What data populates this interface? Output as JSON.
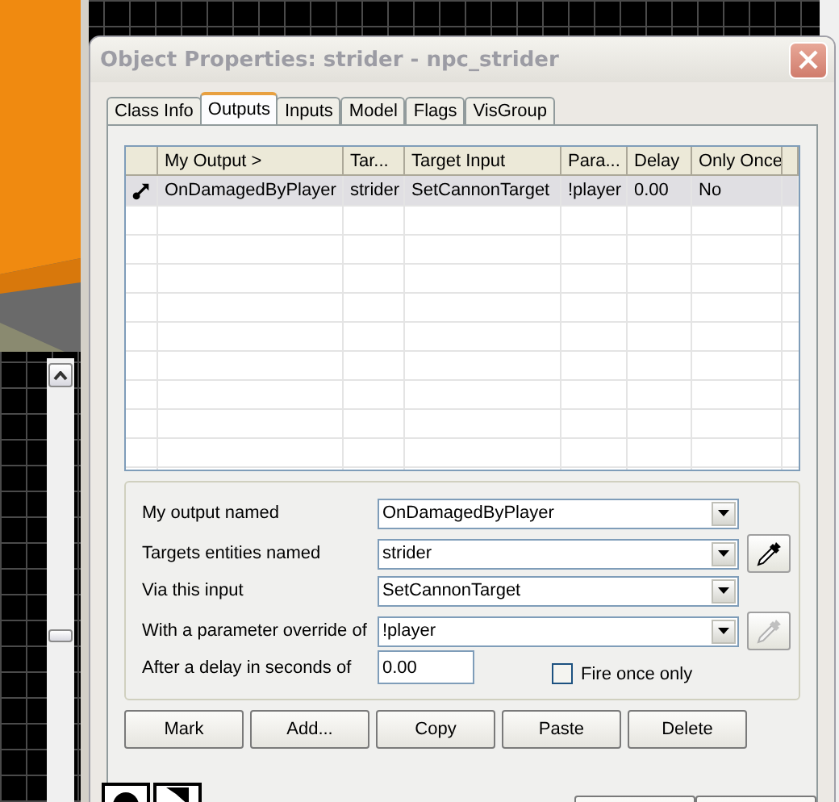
{
  "window": {
    "title": "Object Properties: strider - npc_strider",
    "active": false
  },
  "tabs": [
    {
      "label": "Class Info",
      "selected": false
    },
    {
      "label": "Outputs",
      "selected": true
    },
    {
      "label": "Inputs",
      "selected": false
    },
    {
      "label": "Model",
      "selected": false
    },
    {
      "label": "Flags",
      "selected": false
    },
    {
      "label": "VisGroup",
      "selected": false
    }
  ],
  "table": {
    "columns": [
      "My Output >",
      "Tar...",
      "Target Input",
      "Para...",
      "Delay",
      "Only Once"
    ],
    "rows": [
      {
        "selected": true,
        "cells": [
          "OnDamagedByPlayer",
          "strider",
          "SetCannonTarget",
          "!player",
          "0.00",
          "No"
        ]
      }
    ]
  },
  "form": {
    "fields": [
      {
        "kind": "combo",
        "label": "My output named",
        "value": "OnDamagedByPlayer",
        "picker": false
      },
      {
        "kind": "combo",
        "label": "Targets entities named",
        "value": "strider",
        "picker": true,
        "picker_disabled": false
      },
      {
        "kind": "combo",
        "label": "Via this input",
        "value": "SetCannonTarget",
        "picker": false
      },
      {
        "kind": "combo",
        "label": "With a parameter override of",
        "value": "!player",
        "picker": true,
        "picker_disabled": true
      },
      {
        "kind": "text",
        "label": "After a delay in seconds of",
        "value": "0.00",
        "picker": false
      }
    ],
    "checkbox": {
      "label": "Fire once only",
      "checked": false
    }
  },
  "buttons": [
    "Mark",
    "Add...",
    "Copy",
    "Paste",
    "Delete"
  ]
}
